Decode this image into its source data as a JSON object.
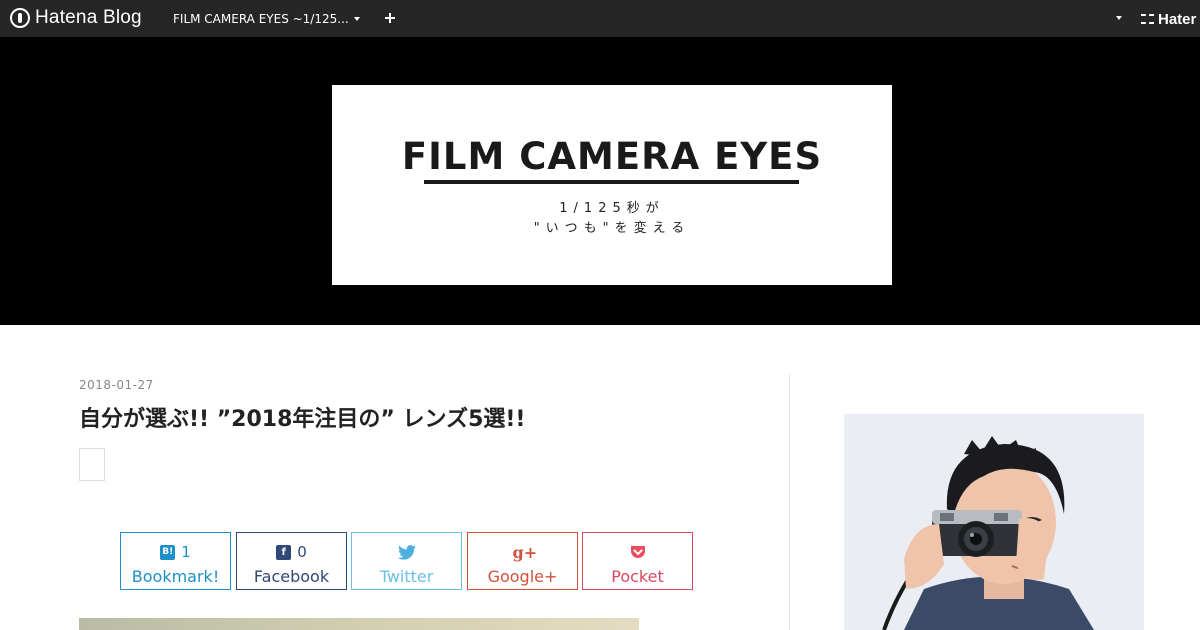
{
  "navbar": {
    "logo_text": "Hatena Blog",
    "blog_switcher_label": "FILM CAMERA EYES ~1/125...",
    "hatena_link": "Hater"
  },
  "header": {
    "banner_title": "FILM CAMERA EYES",
    "banner_subtitle_line1": "1/125秒が",
    "banner_subtitle_line2": "\"いつも\"を変える"
  },
  "entry": {
    "date": "2018-01-27",
    "title": "自分が選ぶ!! ”2018年注目の” レンズ5選!!"
  },
  "share": {
    "hatena": {
      "count": "1",
      "label": "Bookmark!",
      "icon_glyph": "B!"
    },
    "facebook": {
      "count": "0",
      "label": "Facebook",
      "icon_glyph": "f"
    },
    "twitter": {
      "label": "Twitter",
      "icon_glyph": "🐦"
    },
    "google": {
      "label": "Google+",
      "icon_glyph": "g+"
    },
    "pocket": {
      "label": "Pocket",
      "icon_glyph": "⌄"
    }
  },
  "colors": {
    "navbar_bg": "#262626",
    "header_bg": "#000000",
    "hatena_blue": "#1e90c8",
    "facebook_blue": "#2f4877",
    "twitter_blue": "#6bc0e4",
    "google_red": "#d0533c",
    "pocket_red": "#d9485e"
  },
  "icons": {
    "logo": "hatena-blog-logo-icon",
    "add": "plus-icon",
    "dropdown": "chevron-down-icon",
    "hatena": "hatena-icon"
  }
}
